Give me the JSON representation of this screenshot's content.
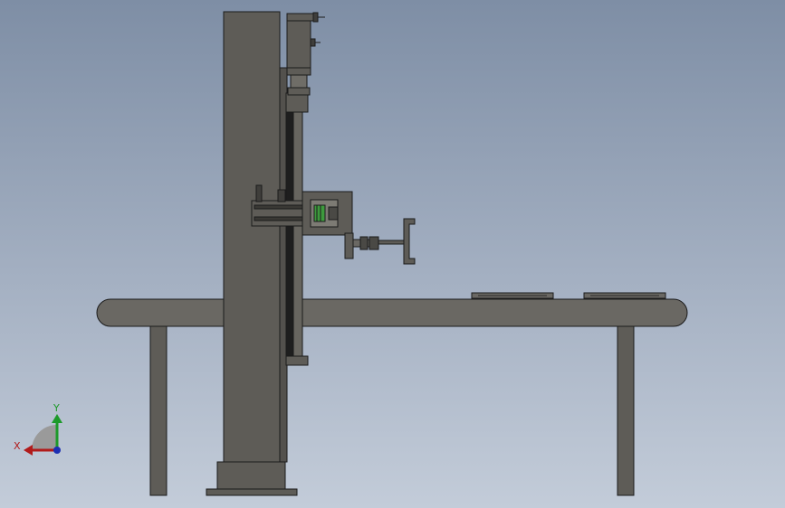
{
  "viewport": {
    "background_top": "#7e8ea5",
    "background_bottom": "#c3ccd9"
  },
  "model": {
    "part_color": "#5e5c57",
    "part_edge": "#1b1b1b",
    "highlight_color": "#3d9a3d"
  },
  "triad": {
    "x_label": "X",
    "y_label": "Y",
    "x_color": "#b11b1b",
    "y_color": "#1d9a2a",
    "z_color": "#1c2fb3"
  }
}
